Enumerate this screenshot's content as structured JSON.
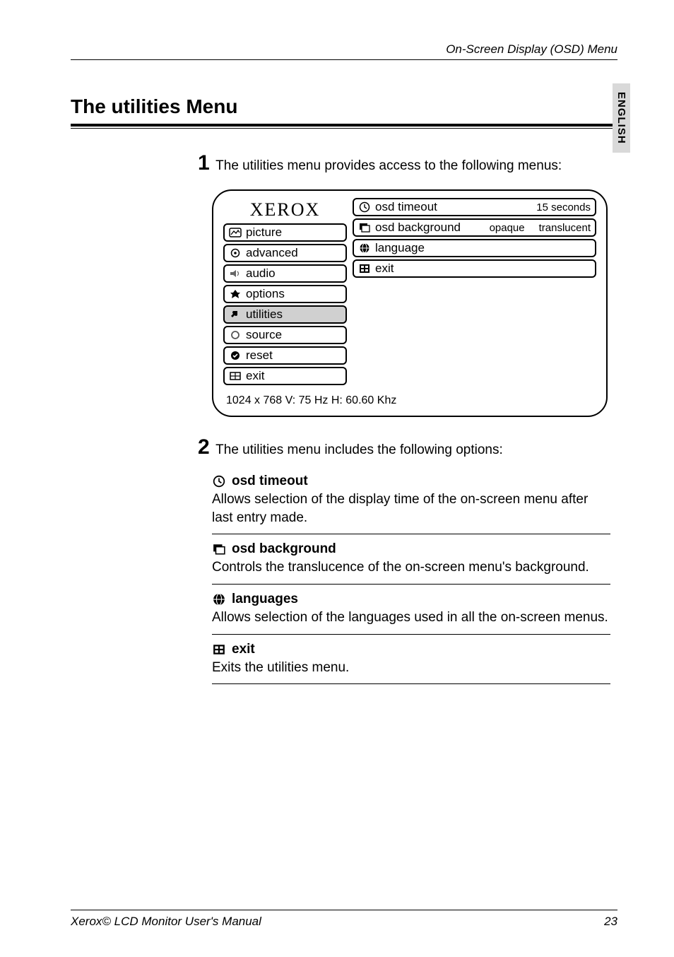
{
  "header": {
    "text": "On-Screen Display (OSD) Menu"
  },
  "sideTab": {
    "text": "ENGLISH"
  },
  "title": "The utilities Menu",
  "step1": {
    "num": "1",
    "text": "The utilities menu provides access to the following menus:"
  },
  "osd": {
    "brand": "XEROX",
    "left": [
      {
        "icon": "picture-icon",
        "label": "picture"
      },
      {
        "icon": "advanced-icon",
        "label": "advanced"
      },
      {
        "icon": "audio-icon",
        "label": "audio"
      },
      {
        "icon": "options-icon",
        "label": "options"
      },
      {
        "icon": "utilities-icon",
        "label": "utilities",
        "selected": true
      },
      {
        "icon": "source-icon",
        "label": "source"
      },
      {
        "icon": "reset-icon",
        "label": "reset"
      },
      {
        "icon": "exit-icon",
        "label": "exit"
      }
    ],
    "right": [
      {
        "icon": "clock-icon",
        "label": "osd timeout",
        "value": "15 seconds"
      },
      {
        "icon": "window-icon",
        "label": "osd background",
        "valueA": "opaque",
        "valueB": "translucent"
      },
      {
        "icon": "globe-icon",
        "label": "language"
      },
      {
        "icon": "grid-exit-icon",
        "label": "exit"
      }
    ],
    "status": "1024 x 768 V: 75 Hz   H: 60.60 Khz"
  },
  "step2": {
    "num": "2",
    "text": "The utilities menu includes the following options:"
  },
  "options": [
    {
      "icon": "clock-icon",
      "title": "osd timeout",
      "desc": "Allows selection of the display time of the on-screen menu after last entry made."
    },
    {
      "icon": "window-icon",
      "title": "osd background",
      "desc": "Controls the translucence of  the on-screen menu's background."
    },
    {
      "icon": "globe-icon",
      "title": "languages",
      "desc": "Allows selection of the languages used in all the on-screen menus."
    },
    {
      "icon": "grid-exit-icon",
      "title": "exit",
      "desc": "Exits the utilities menu."
    }
  ],
  "footer": {
    "left": "Xerox© LCD Monitor User's Manual",
    "right": "23"
  }
}
